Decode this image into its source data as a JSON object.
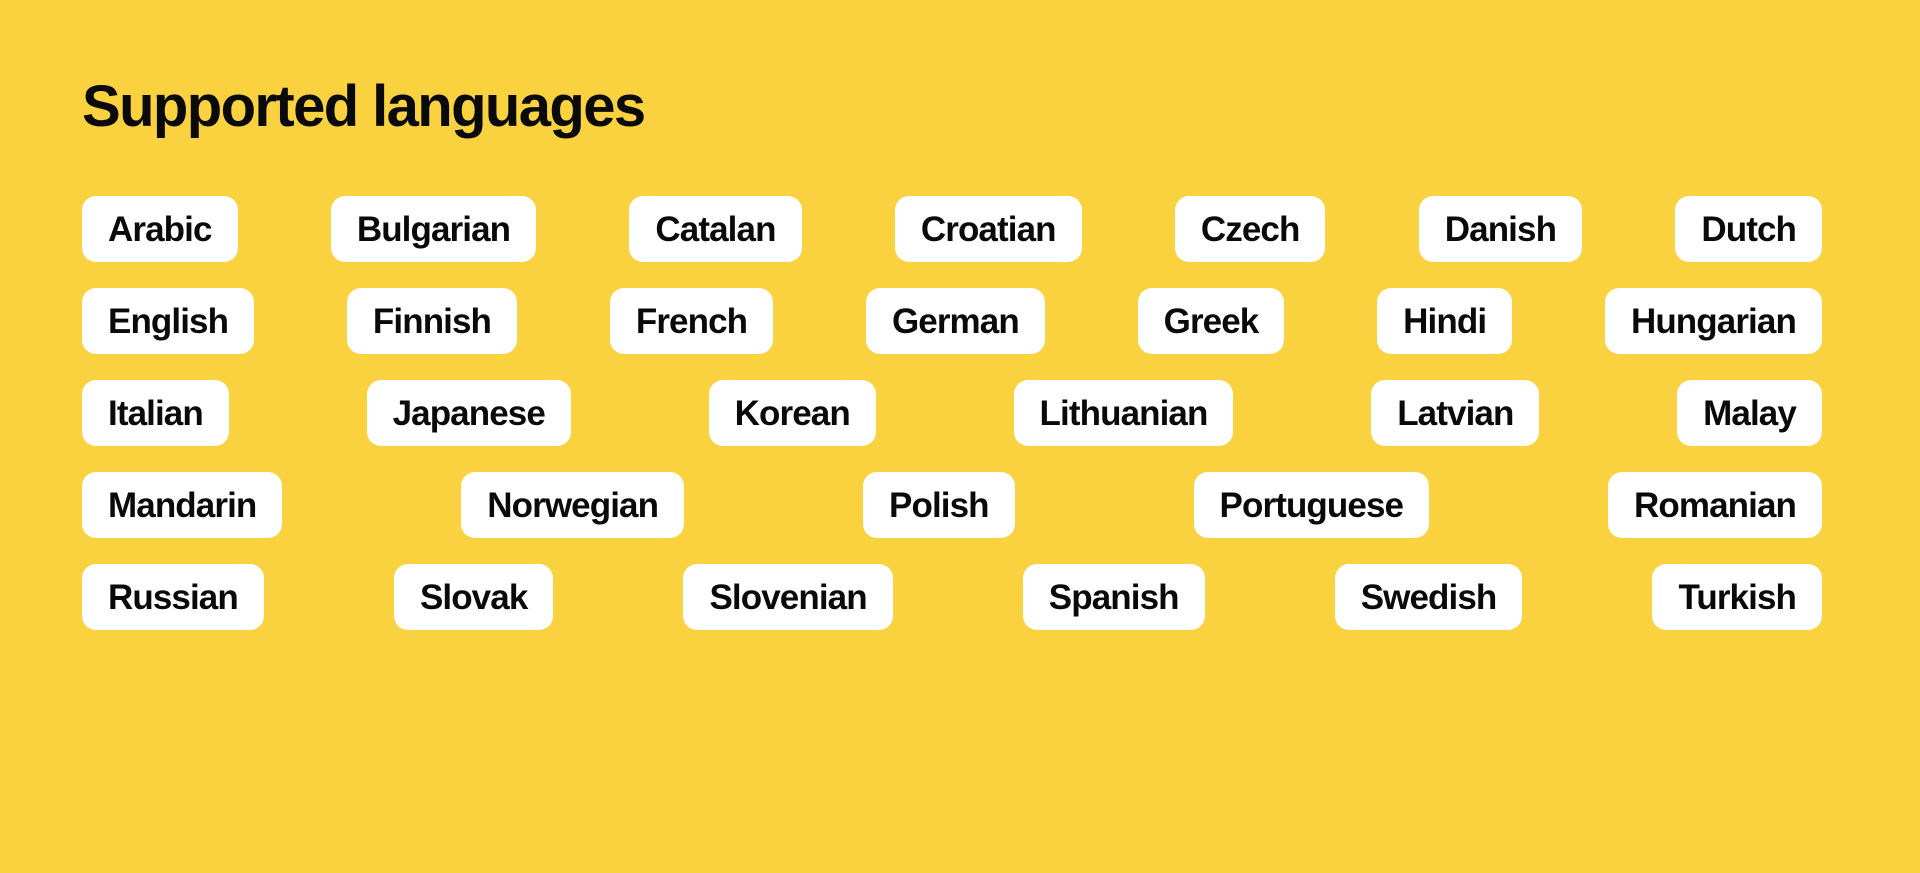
{
  "theme": {
    "background_color": "#FAD23F",
    "pill_background_color": "#FFFFFF",
    "text_color": "#0A0A0A"
  },
  "header": {
    "title": "Supported languages"
  },
  "languages": {
    "rows": [
      {
        "items": [
          {
            "label": "Arabic"
          },
          {
            "label": "Bulgarian"
          },
          {
            "label": "Catalan"
          },
          {
            "label": "Croatian"
          },
          {
            "label": "Czech"
          },
          {
            "label": "Danish"
          },
          {
            "label": "Dutch"
          }
        ]
      },
      {
        "items": [
          {
            "label": "English"
          },
          {
            "label": "Finnish"
          },
          {
            "label": "French"
          },
          {
            "label": "German"
          },
          {
            "label": "Greek"
          },
          {
            "label": "Hindi"
          },
          {
            "label": "Hungarian"
          }
        ]
      },
      {
        "items": [
          {
            "label": "Italian"
          },
          {
            "label": "Japanese"
          },
          {
            "label": "Korean"
          },
          {
            "label": "Lithuanian"
          },
          {
            "label": "Latvian"
          },
          {
            "label": "Malay"
          }
        ]
      },
      {
        "items": [
          {
            "label": "Mandarin"
          },
          {
            "label": "Norwegian"
          },
          {
            "label": "Polish"
          },
          {
            "label": "Portuguese"
          },
          {
            "label": "Romanian"
          }
        ]
      },
      {
        "items": [
          {
            "label": "Russian"
          },
          {
            "label": "Slovak"
          },
          {
            "label": "Slovenian"
          },
          {
            "label": "Spanish"
          },
          {
            "label": "Swedish"
          },
          {
            "label": "Turkish"
          }
        ]
      }
    ]
  }
}
